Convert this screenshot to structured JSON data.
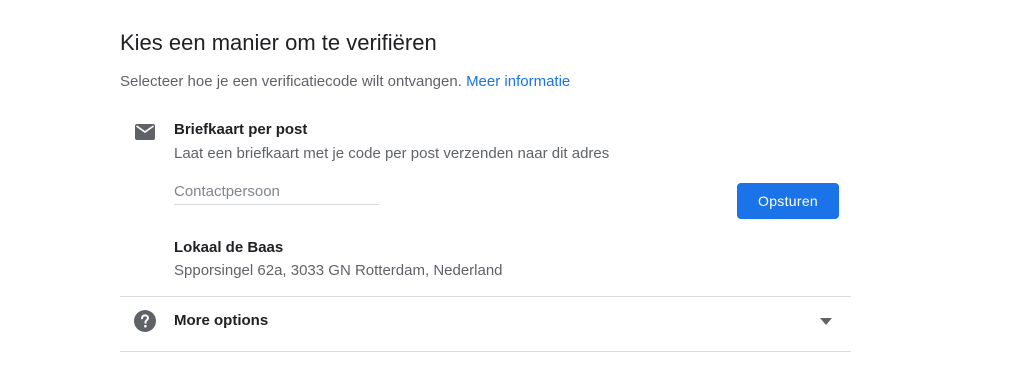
{
  "header": {
    "title": "Kies een manier om te verifiëren",
    "subtitle": "Selecteer hoe je een verificatiecode wilt ontvangen.",
    "link": "Meer informatie"
  },
  "option": {
    "icon": "mail-icon",
    "title": "Briefkaart per post",
    "description": "Laat een briefkaart met je code per post verzenden naar dit adres",
    "contact_placeholder": "Contactpersoon",
    "contact_value": "",
    "send_label": "Opsturen",
    "business_name": "Lokaal de Baas",
    "business_address": "Spporsingel 62a, 3033 GN Rotterdam, Nederland"
  },
  "more": {
    "icon": "help-icon",
    "label": "More options",
    "chevron": "chevron-down-icon"
  },
  "colors": {
    "accent": "#1a73e8",
    "text": "#202124",
    "secondary_text": "#5f6368",
    "icon": "#5f6368",
    "divider": "#dadce0"
  }
}
